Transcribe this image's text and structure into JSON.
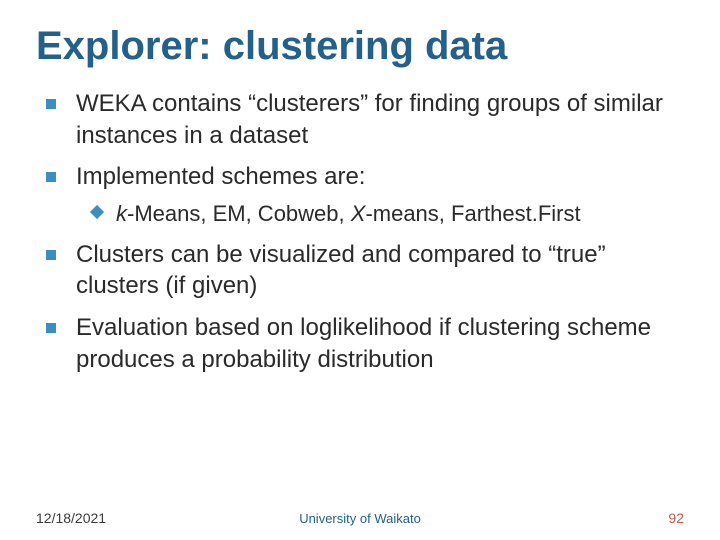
{
  "title": "Explorer: clustering data",
  "bullets": {
    "b0": "WEKA contains “clusterers” for finding groups of similar instances in a dataset",
    "b1": "Implemented schemes are:",
    "b1_sub0_prefix": "k",
    "b1_sub0_rest": "-Means, EM, Cobweb, ",
    "b1_sub0_x": "X",
    "b1_sub0_tail": "-means, Farthest.First",
    "b2": "Clusters can be visualized and compared to “true” clusters (if given)",
    "b3": "Evaluation based on loglikelihood if clustering scheme produces a probability distribution"
  },
  "footer": {
    "date": "12/18/2021",
    "org": "University of Waikato",
    "page": "92"
  }
}
